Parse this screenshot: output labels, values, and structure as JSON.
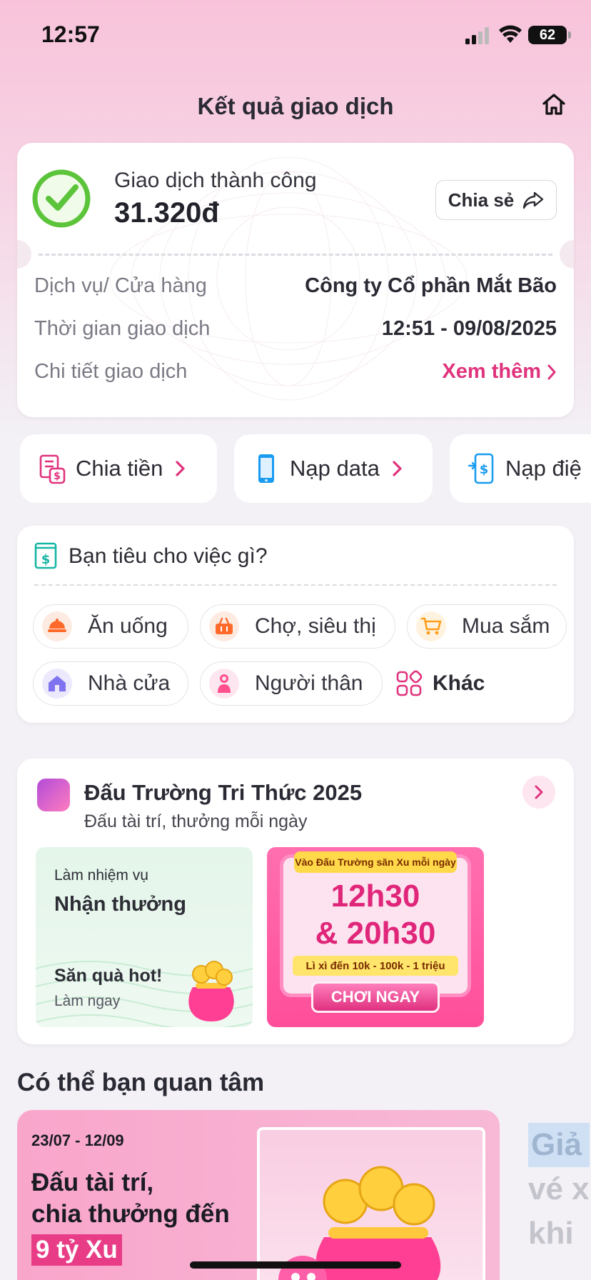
{
  "status_bar": {
    "time": "12:57",
    "battery": "62"
  },
  "header": {
    "title": "Kết quả giao dịch"
  },
  "result": {
    "status": "Giao dịch thành công",
    "amount": "31.320đ",
    "share_label": "Chia sẻ",
    "rows": [
      {
        "label": "Dịch vụ/ Cửa hàng",
        "value": "Công ty Cổ phần Mắt Bão"
      },
      {
        "label": "Thời gian giao dịch",
        "value": "12:51 - 09/08/2025"
      },
      {
        "label": "Chi tiết giao dịch",
        "value": "Xem thêm"
      }
    ]
  },
  "quick_actions": [
    {
      "label": "Chia tiền",
      "icon": "split-bill-icon"
    },
    {
      "label": "Nạp data",
      "icon": "phone-icon"
    },
    {
      "label": "Nạp điệ",
      "icon": "phone-dollar-icon"
    }
  ],
  "spend": {
    "title": "Bạn tiêu cho việc gì?",
    "categories": [
      {
        "label": "Ăn uống",
        "icon": "food-icon"
      },
      {
        "label": "Chợ, siêu thị",
        "icon": "basket-icon"
      },
      {
        "label": "Mua sắm",
        "icon": "cart-icon"
      },
      {
        "label": "Nhà cửa",
        "icon": "house-icon"
      },
      {
        "label": "Người thân",
        "icon": "person-icon"
      }
    ],
    "other_label": "Khác"
  },
  "arena": {
    "title": "Đấu Trường Tri Thức 2025",
    "subtitle": "Đấu tài trí, thưởng mỗi ngày",
    "task": {
      "line1": "Làm nhiệm vụ",
      "line2": "Nhận thưởng",
      "line3": "Săn quà hot!",
      "line4": "Làm ngay"
    },
    "promo": {
      "tag": "Vào Đấu Trường săn Xu mỗi ngày",
      "time1": "12h30",
      "time2": "& 20h30",
      "sub": "Lì xì đến 10k - 100k - 1 triệu",
      "cta": "CHƠI NGAY"
    }
  },
  "suggest": {
    "title": "Có thể bạn quan tâm",
    "banner": {
      "date": "23/07 - 12/09",
      "line1": "Đấu tài trí,",
      "line2": "chia thưởng đến",
      "highlight": "9 tỷ Xu"
    },
    "peek": [
      "Giả",
      "vé x",
      "khi"
    ]
  },
  "colors": {
    "accent": "#e0337d",
    "success": "#5cc43a"
  }
}
